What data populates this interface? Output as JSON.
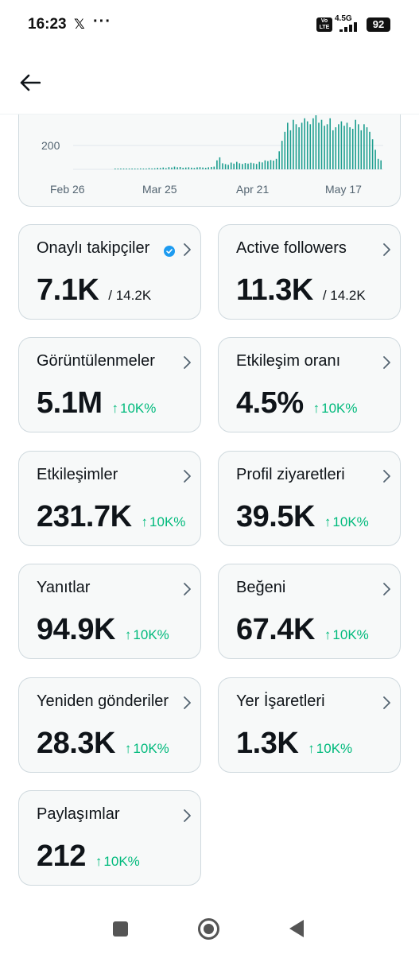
{
  "status_bar": {
    "time": "16:23",
    "x_logo": "𝕏",
    "more": "···",
    "volte": "Vo\nLTE",
    "network": "4.5G",
    "battery": "92"
  },
  "header": {
    "back_icon": "arrow-left-icon"
  },
  "chart_data": {
    "type": "bar",
    "x_ticks": [
      "Feb 26",
      "Mar 25",
      "Apr 21",
      "May 17"
    ],
    "y_ticks": [
      200
    ],
    "color": "#1d9e8f",
    "values": [
      2,
      2,
      3,
      2,
      3,
      4,
      3,
      5,
      4,
      6,
      5,
      4,
      8,
      6,
      7,
      10,
      9,
      12,
      8,
      15,
      12,
      18,
      14,
      16,
      10,
      12,
      14,
      11,
      9,
      13,
      15,
      12,
      10,
      14,
      16,
      18,
      60,
      80,
      40,
      35,
      30,
      45,
      38,
      50,
      40,
      36,
      42,
      38,
      44,
      40,
      36,
      50,
      46,
      60,
      55,
      62,
      58,
      70,
      120,
      190,
      250,
      310,
      260,
      330,
      300,
      280,
      310,
      340,
      320,
      300,
      340,
      360,
      310,
      330,
      290,
      300,
      340,
      260,
      280,
      300,
      320,
      290,
      310,
      280,
      270,
      330,
      300,
      260,
      300,
      280,
      250,
      200,
      130,
      70,
      60
    ],
    "grid": true,
    "ylim": [
      0,
      360
    ]
  },
  "cards": [
    {
      "title": "Onaylı takipçiler",
      "value": "7.1K",
      "total": "/ 14.2K",
      "change": "",
      "verified": true
    },
    {
      "title": "Active followers",
      "value": "11.3K",
      "total": "/ 14.2K",
      "change": "",
      "verified": false
    },
    {
      "title": "Görüntülenmeler",
      "value": "5.1M",
      "total": "",
      "change": "10K%",
      "verified": false
    },
    {
      "title": "Etkileşim oranı",
      "value": "4.5%",
      "total": "",
      "change": "10K%",
      "verified": false
    },
    {
      "title": "Etkileşimler",
      "value": "231.7K",
      "total": "",
      "change": "10K%",
      "verified": false
    },
    {
      "title": "Profil ziyaretleri",
      "value": "39.5K",
      "total": "",
      "change": "10K%",
      "verified": false
    },
    {
      "title": "Yanıtlar",
      "value": "94.9K",
      "total": "",
      "change": "10K%",
      "verified": false
    },
    {
      "title": "Beğeni",
      "value": "67.4K",
      "total": "",
      "change": "10K%",
      "verified": false
    },
    {
      "title": "Yeniden gönderiler",
      "value": "28.3K",
      "total": "",
      "change": "10K%",
      "verified": false
    },
    {
      "title": "Yer İşaretleri",
      "value": "1.3K",
      "total": "",
      "change": "10K%",
      "verified": false
    },
    {
      "title": "Paylaşımlar",
      "value": "212",
      "total": "",
      "change": "10K%",
      "verified": false
    }
  ],
  "change_arrow": "↑",
  "nav": {
    "recents_icon": "square-icon",
    "home_icon": "circle-home-icon",
    "back_icon": "triangle-back-icon"
  },
  "colors": {
    "positive": "#00ba7c",
    "verified": "#1d9bf0",
    "card_bg": "#f7f9f9",
    "card_border": "#cfd9de"
  }
}
